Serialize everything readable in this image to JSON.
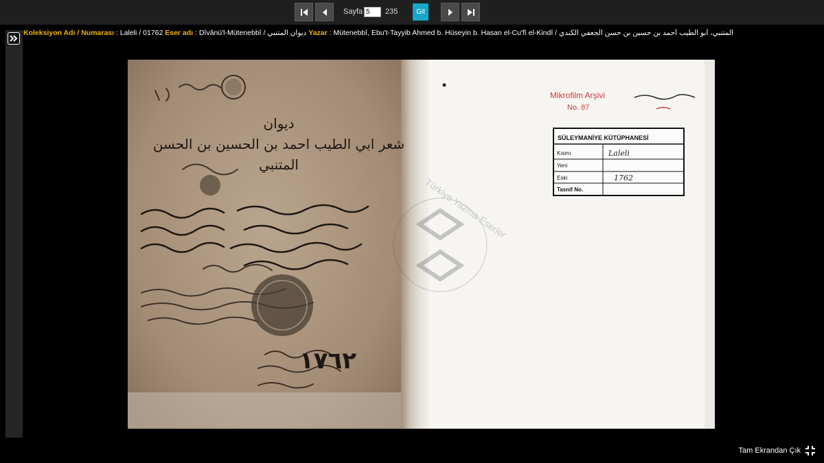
{
  "toolbar": {
    "page_label": "Sayfa",
    "current_page": "5",
    "total_pages": "235",
    "go_label": "Git",
    "buttons": [
      "first-page-icon",
      "previous-page-icon",
      "next-page-icon",
      "last-page-icon"
    ]
  },
  "info": {
    "collection_label": "Koleksiyon Adı / Numarası",
    "collection_value": ": Laleli / 01762",
    "work_label": "Eser adı",
    "work_value": ": Dîvânü'l-Mütenebbî / ديوان المتنبي",
    "author_label": "Yazar",
    "author_value": ": Mütenebbî, Ebu't-Tayyib Ahmed b. Hüseyin b. Hasan el-Cu'fî el-Kindî / المتنبي، أبو الطيب أحمد بن حسين بن حسن الجعفي الكندي"
  },
  "manuscript": {
    "left_page_title_line1": "ديوان",
    "left_page_title_line2": "شعر ابي الطيب احمد بن الحسين بن الحسن",
    "left_page_title_line3": "المتنبي",
    "left_page_number": "١٧٦٢",
    "stamp_archive": "Mikrofilm Arşivi",
    "stamp_no": "No. 87",
    "library_card": {
      "header": "SÜLEYMANİYE KÜTÜPHANESİ",
      "rows": [
        {
          "label": "Kısmı",
          "value": "Laleli"
        },
        {
          "label": "Yeni",
          "value": ""
        },
        {
          "label": "Eski",
          "value": "1762"
        },
        {
          "label": "Tasnif No.",
          "value": ""
        }
      ]
    },
    "watermark": "Türkiye Yazma Eserler"
  },
  "footer": {
    "fullscreen_label": "Tam Ekrandan Çık"
  },
  "colors": {
    "accent": "#16a7c8",
    "label_gold": "#f0b400",
    "toolbar_bg": "#1f1f1f"
  }
}
